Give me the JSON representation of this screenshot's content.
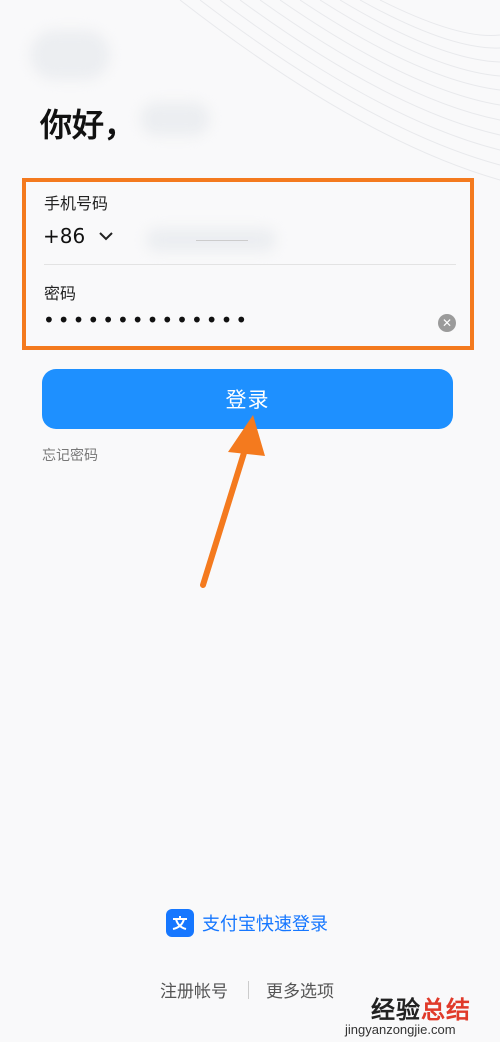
{
  "greeting": "你好，",
  "phone_field": {
    "label": "手机号码",
    "country_code": "+86"
  },
  "password_field": {
    "label": "密码",
    "masked_value": "••••••••••••••"
  },
  "login_button": "登录",
  "forgot_password": "忘记密码",
  "alipay_login": "支付宝快速登录",
  "register": "注册帐号",
  "more_options": "更多选项",
  "watermark": {
    "chinese_prefix": "经验",
    "chinese_suffix": "总结",
    "url": "jingyanzongjie.com"
  },
  "colors": {
    "primary": "#1e90ff",
    "highlight": "#f47a1e",
    "alipay": "#1677ff"
  },
  "icons": [
    "chevron-down-icon",
    "clear-icon",
    "alipay-icon",
    "arrow-annotation-icon"
  ]
}
